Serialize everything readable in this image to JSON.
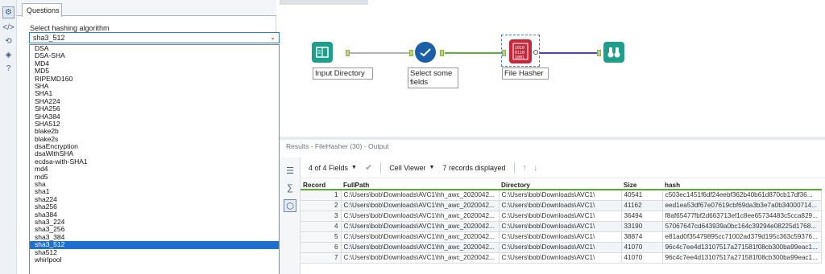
{
  "config": {
    "tab_label": "Questions",
    "select_label": "Select hashing algorithm",
    "selected_value": "sha3_512",
    "options": [
      "DSA",
      "DSA-SHA",
      "MD4",
      "MD5",
      "RIPEMD160",
      "SHA",
      "SHA1",
      "SHA224",
      "SHA256",
      "SHA384",
      "SHA512",
      "blake2b",
      "blake2s",
      "dsaEncryption",
      "dsaWithSHA",
      "ecdsa-with-SHA1",
      "md4",
      "md5",
      "sha",
      "sha1",
      "sha224",
      "sha256",
      "sha384",
      "sha3_224",
      "sha3_256",
      "sha3_384",
      "sha3_512",
      "sha512",
      "whirlpool"
    ]
  },
  "workflow": {
    "nodes": [
      {
        "label": "Input Directory",
        "icon": "input-directory-icon"
      },
      {
        "label": "Select some fields",
        "icon": "select-icon"
      },
      {
        "label": "File Hasher",
        "icon": "file-hasher-icon"
      },
      {
        "label": "",
        "icon": "browse-binoculars-icon"
      }
    ]
  },
  "results": {
    "title": "Results - FileHasher (30) - Output",
    "fields_label": "4 of 4 Fields",
    "viewer_label": "Cell Viewer",
    "records_label": "7 records displayed",
    "columns": [
      "Record",
      "FullPath",
      "Directory",
      "Size",
      "hash"
    ],
    "rows": [
      [
        "1",
        "C:\\Users\\bob\\Downloads\\AVC1\\hh_awc_2020042...",
        "C:\\Users\\bob\\Downloads\\AVC1\\",
        "40541",
        "c503ec1451f6df24eebf362b40b61d870cb17df36..."
      ],
      [
        "2",
        "C:\\Users\\bob\\Downloads\\AVC1\\hh_awc_2020042...",
        "C:\\Users\\bob\\Downloads\\AVC1\\",
        "41162",
        "eed1ea53df67e07619cbf69da3b3e7a0b34000714..."
      ],
      [
        "3",
        "C:\\Users\\bob\\Downloads\\AVC1\\hh_awc_2020042...",
        "C:\\Users\\bob\\Downloads\\AVC1\\",
        "36494",
        "f8af65477fbf2d663713ef1c8ee65734483c5cca829..."
      ],
      [
        "4",
        "C:\\Users\\bob\\Downloads\\AVC1\\hh_awc_2020042...",
        "C:\\Users\\bob\\Downloads\\AVC1\\",
        "33190",
        "57067647cd643939a0bc164c39294e08225d1768..."
      ],
      [
        "5",
        "C:\\Users\\bob\\Downloads\\AVC1\\hh_awc_2020042...",
        "C:\\Users\\bob\\Downloads\\AVC1\\",
        "38874",
        "e81ad0f35479895cc71002ad379d195c363c59376..."
      ],
      [
        "6",
        "C:\\Users\\bob\\Downloads\\AVC1\\hh_awc_2020042...",
        "C:\\Users\\bob\\Downloads\\AVC1\\",
        "41070",
        "96c4c7ee4d13107517a271581f08cb300ba99eac1..."
      ],
      [
        "7",
        "C:\\Users\\bob\\Downloads\\AVC1\\hh_awc_2020042...",
        "C:\\Users\\bob\\Downloads\\AVC1\\",
        "41070",
        "96c4c7ee4d13107517a271581f08cb300ba99eac1..."
      ]
    ]
  },
  "colors": {
    "accent": "#1e6fd0",
    "grid_header_rule": "#5aa832",
    "connection_green": "#5bb03a",
    "connection_blue": "#4b3fd0"
  }
}
